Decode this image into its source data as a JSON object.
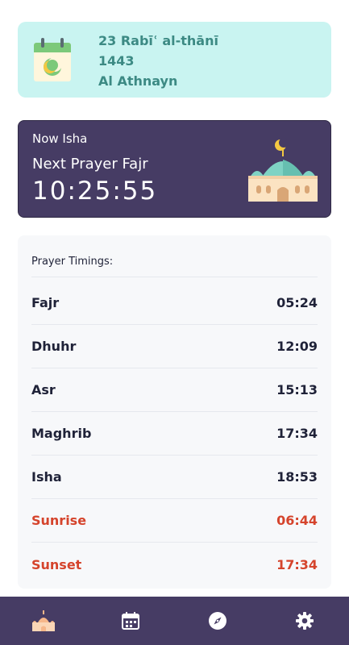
{
  "hijri": {
    "date_line": "23 Rabīʿ al-thānī",
    "year": "1443",
    "weekday": "Al Athnayn",
    "icon": "calendar-moon-icon"
  },
  "prayer_status": {
    "now_label": "Now Isha",
    "next_label": "Next Prayer Fajr",
    "countdown": "10:25:55",
    "icon": "mosque-icon"
  },
  "timings": {
    "title": "Prayer Timings:",
    "rows": [
      {
        "name": "Fajr",
        "time": "05:24"
      },
      {
        "name": "Dhuhr",
        "time": "12:09"
      },
      {
        "name": "Asr",
        "time": "15:13"
      },
      {
        "name": "Maghrib",
        "time": "17:34"
      },
      {
        "name": "Isha",
        "time": "18:53"
      },
      {
        "name": "Sunrise",
        "time": "06:44"
      },
      {
        "name": "Sunset",
        "time": "17:34"
      }
    ]
  },
  "nav": {
    "items": [
      {
        "icon": "mosque-icon",
        "active": true
      },
      {
        "icon": "calendar-icon",
        "active": false
      },
      {
        "icon": "compass-icon",
        "active": false
      },
      {
        "icon": "gear-icon",
        "active": false
      }
    ]
  },
  "colors": {
    "accent_dark": "#463c64",
    "hijri_bg": "#c9f4f1",
    "hijri_text": "#3c8a84",
    "highlight_red": "#d5442c"
  }
}
